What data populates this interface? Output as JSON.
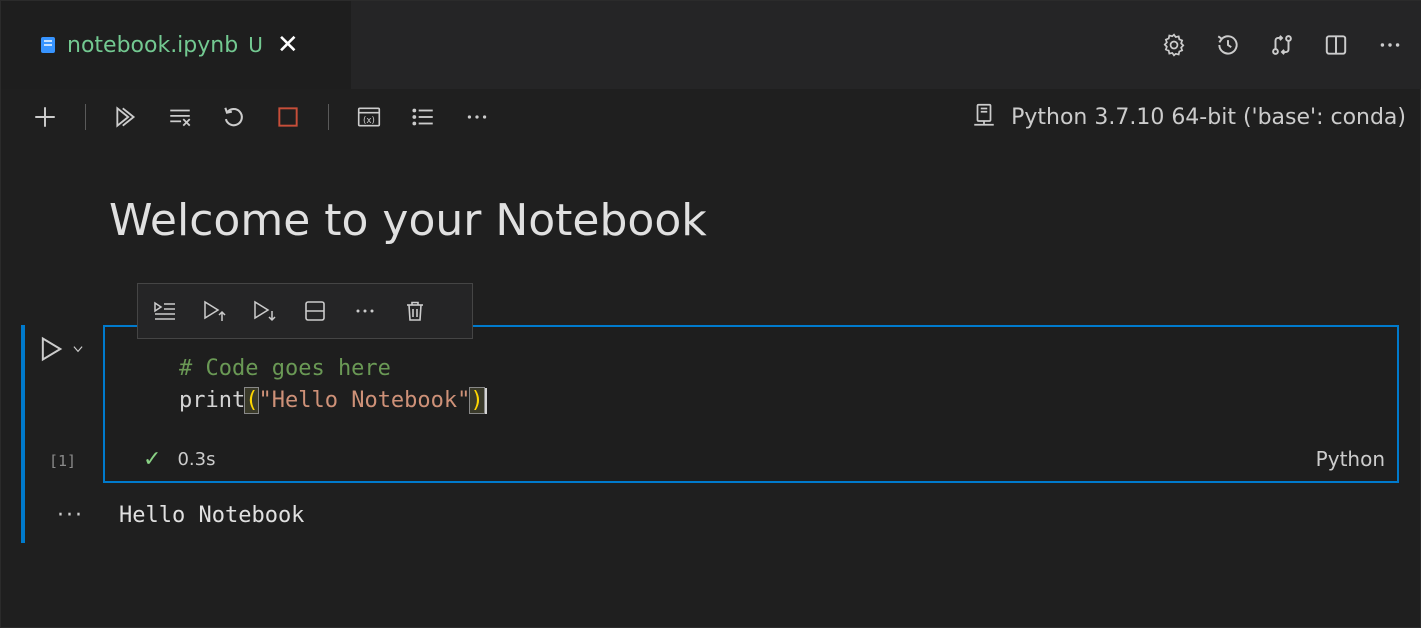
{
  "tab": {
    "filename": "notebook.ipynb",
    "status": "U",
    "close": "✕"
  },
  "editor_actions": [
    "gear-icon",
    "history-icon",
    "git-compare-icon",
    "split-editor-icon",
    "more-icon"
  ],
  "toolbar": {
    "items": [
      "add-cell",
      "run-all",
      "clear-outputs",
      "restart",
      "interrupt",
      "variables",
      "outline",
      "more"
    ],
    "kernel_label": "Python 3.7.10 64-bit ('base': conda)"
  },
  "markdown": {
    "heading": "Welcome to your Notebook"
  },
  "cell": {
    "execution_count": "[1]",
    "code": {
      "comment": "# Code goes here",
      "fn": "print",
      "open_paren": "(",
      "string": "\"Hello Notebook\"",
      "close_paren": ")"
    },
    "status_icon": "✓",
    "duration": "0.3s",
    "language": "Python",
    "toolbar_items": [
      "execute-above",
      "run-above",
      "run-below",
      "split-cell",
      "more",
      "delete"
    ]
  },
  "output": {
    "ellipsis": "···",
    "text": "Hello Notebook"
  },
  "colors": {
    "accent": "#007acc",
    "modified": "#73c991",
    "comment": "#6a9955",
    "string": "#ce9178",
    "bracket": "#ffd700",
    "interrupt": "#c74e39"
  }
}
